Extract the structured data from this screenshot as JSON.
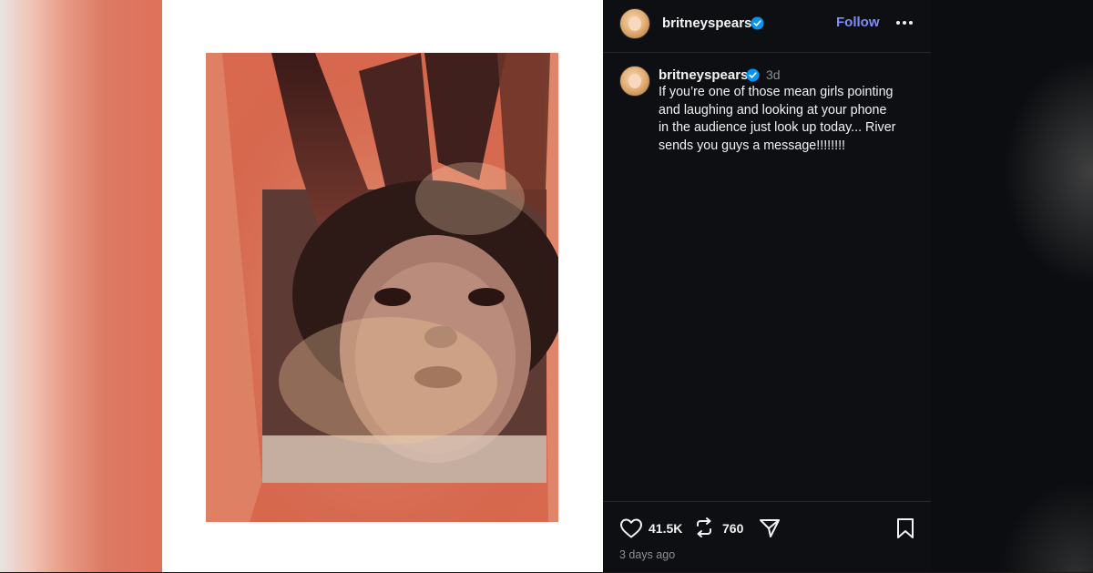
{
  "post": {
    "header": {
      "username": "britneyspears",
      "follow_label": "Follow"
    },
    "caption": {
      "username": "britneyspears",
      "time_short": "3d",
      "text": "If you’re one of those mean girls pointing\nand laughing and looking at your phone\nin the audience just look up today... River\nsends you guys a message!!!!!!!!"
    },
    "actions": {
      "likes": "41.5K",
      "reposts": "760"
    },
    "time_ago": "3 days ago"
  },
  "icons": {
    "verified": "verified-badge-icon",
    "more": "more-options-icon",
    "like": "heart-icon",
    "repost": "repost-icon",
    "share": "send-icon",
    "save": "bookmark-icon"
  },
  "colors": {
    "panel_bg": "#0d0f12",
    "accent_follow": "#7e8dfb",
    "verified_blue": "#0095f6",
    "muted_text": "#8e8e8e"
  }
}
